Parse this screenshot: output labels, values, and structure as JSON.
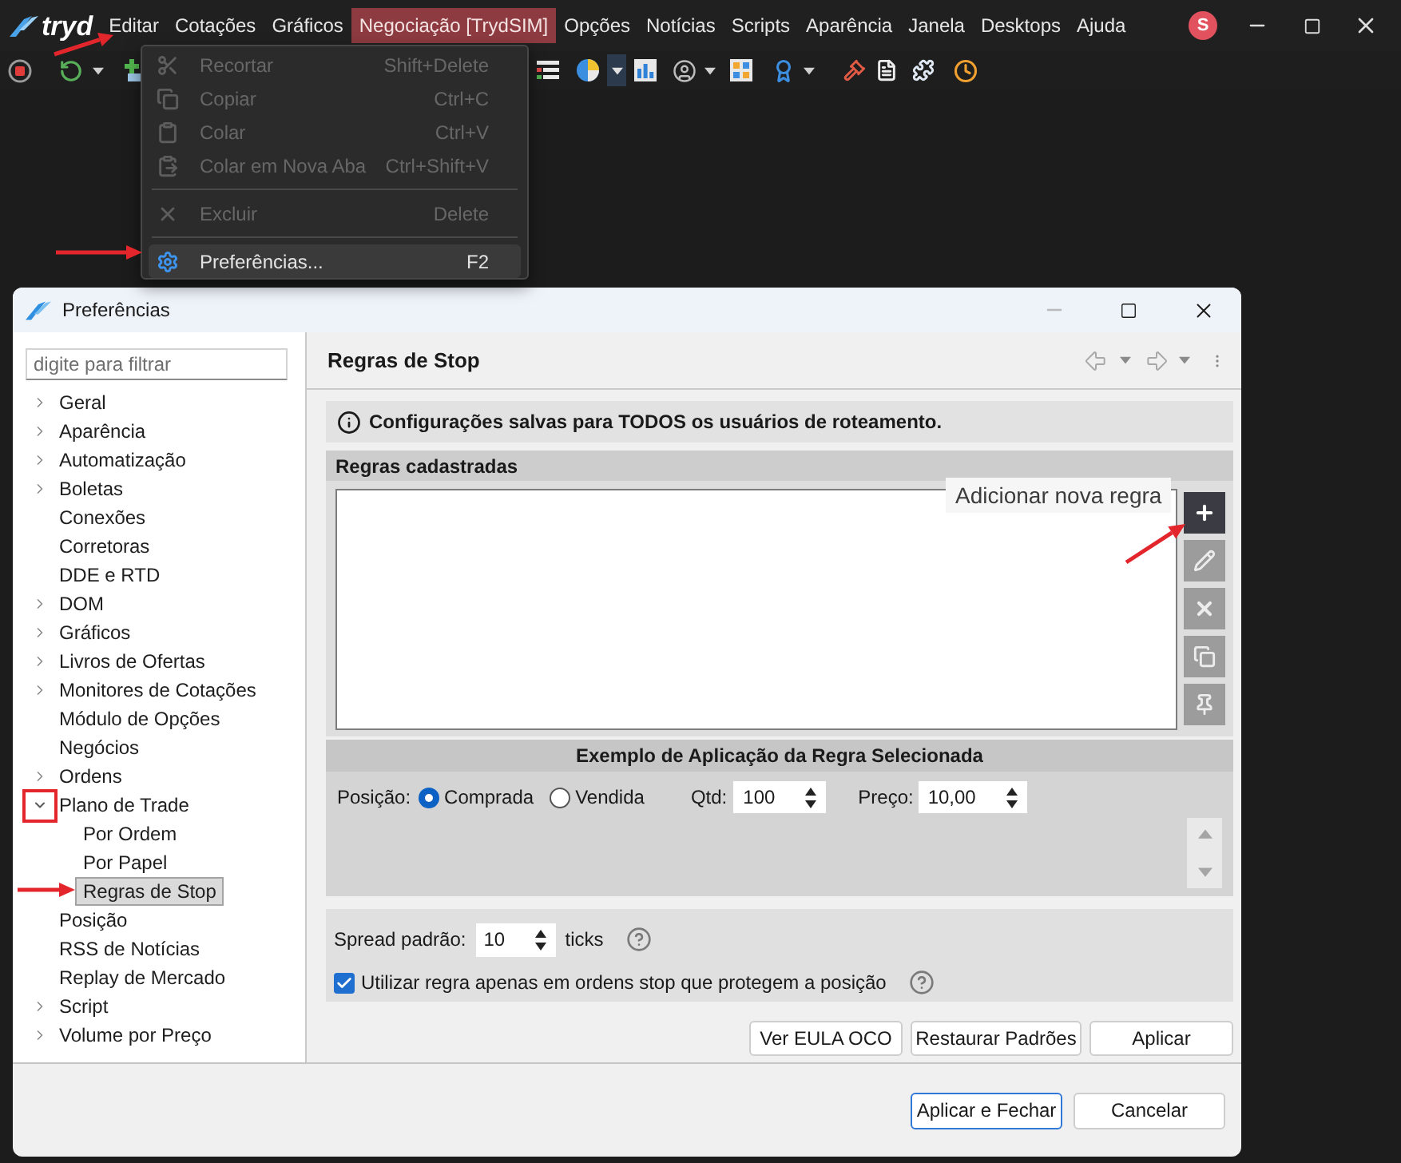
{
  "app": {
    "logo": "tryd"
  },
  "menu_bar": [
    {
      "label": "Editar",
      "highlighted": false
    },
    {
      "label": "Cotações",
      "highlighted": false
    },
    {
      "label": "Gráficos",
      "highlighted": false
    },
    {
      "label": "Negociação [TrydSIM]",
      "highlighted": true
    },
    {
      "label": "Opções",
      "highlighted": false
    },
    {
      "label": "Notícias",
      "highlighted": false
    },
    {
      "label": "Scripts",
      "highlighted": false
    },
    {
      "label": "Aparência",
      "highlighted": false
    },
    {
      "label": "Janela",
      "highlighted": false
    },
    {
      "label": "Desktops",
      "highlighted": false
    },
    {
      "label": "Ajuda",
      "highlighted": false
    }
  ],
  "account": {
    "initial": "S"
  },
  "edit_menu": {
    "items": [
      {
        "kind": "item",
        "label": "Recortar",
        "shortcut": "Shift+Delete",
        "disabled": true,
        "selected": false
      },
      {
        "kind": "item",
        "label": "Copiar",
        "shortcut": "Ctrl+C",
        "disabled": true,
        "selected": false
      },
      {
        "kind": "item",
        "label": "Colar",
        "shortcut": "Ctrl+V",
        "disabled": true,
        "selected": false
      },
      {
        "kind": "item",
        "label": "Colar em Nova Aba",
        "shortcut": "Ctrl+Shift+V",
        "disabled": true,
        "selected": false
      },
      {
        "kind": "separator"
      },
      {
        "kind": "item",
        "label": "Excluir",
        "shortcut": "Delete",
        "disabled": true,
        "selected": false
      },
      {
        "kind": "separator"
      },
      {
        "kind": "item",
        "label": "Preferências...",
        "shortcut": "F2",
        "disabled": false,
        "selected": true
      }
    ]
  },
  "dialog": {
    "title": "Preferências",
    "filter": {
      "placeholder": "digite para filtrar"
    },
    "tree": [
      {
        "label": "Geral",
        "expanded": false,
        "selected": false
      },
      {
        "label": "Aparência",
        "expanded": false,
        "selected": false
      },
      {
        "label": "Automatização",
        "expanded": false,
        "selected": false
      },
      {
        "label": "Boletas",
        "expanded": false,
        "selected": false
      },
      {
        "label": "Conexões",
        "selected": false
      },
      {
        "label": "Corretoras",
        "selected": false
      },
      {
        "label": "DDE e RTD",
        "selected": false
      },
      {
        "label": "DOM",
        "expanded": false,
        "selected": false
      },
      {
        "label": "Gráficos",
        "expanded": false,
        "selected": false
      },
      {
        "label": "Livros de Ofertas",
        "expanded": false,
        "selected": false
      },
      {
        "label": "Monitores de Cotações",
        "expanded": false,
        "selected": false
      },
      {
        "label": "Módulo de Opções",
        "selected": false
      },
      {
        "label": "Negócios",
        "selected": false
      },
      {
        "label": "Ordens",
        "expanded": false,
        "selected": false
      },
      {
        "label": "Plano de Trade",
        "expanded": true,
        "selected": false,
        "children": [
          {
            "label": "Por Ordem",
            "selected": false
          },
          {
            "label": "Por Papel",
            "selected": false
          },
          {
            "label": "Regras de Stop",
            "selected": true
          }
        ]
      },
      {
        "label": "Posição",
        "selected": false
      },
      {
        "label": "RSS de Notícias",
        "selected": false
      },
      {
        "label": "Replay de Mercado",
        "selected": false
      },
      {
        "label": "Script",
        "expanded": false,
        "selected": false
      },
      {
        "label": "Volume por Preço",
        "expanded": false,
        "selected": false
      }
    ],
    "page": {
      "title": "Regras de Stop",
      "info": "Configurações salvas para TODOS os usuários de roteamento.",
      "rules": {
        "title": "Regras cadastradas",
        "tools": [
          {
            "kind": "add",
            "disabled": false
          },
          {
            "kind": "edit",
            "disabled": true
          },
          {
            "kind": "delete",
            "disabled": true
          },
          {
            "kind": "copy",
            "disabled": true
          },
          {
            "kind": "pin",
            "disabled": true
          }
        ],
        "tooltip": "Adicionar nova regra"
      },
      "example": {
        "title": "Exemplo de Aplicação da Regra Selecionada",
        "position_label": "Posição:",
        "positions": [
          {
            "label": "Comprada",
            "selected": true
          },
          {
            "label": "Vendida",
            "selected": false
          }
        ],
        "quantity": {
          "label": "Qtd:",
          "value": "100"
        },
        "price": {
          "label": "Preço:",
          "value": "10,00"
        }
      },
      "spread": {
        "label": "Spread padrão:",
        "value": "10",
        "unit": "ticks"
      },
      "protect_only": {
        "label": "Utilizar regra apenas em ordens stop que protegem a posição",
        "checked": true
      },
      "buttons": [
        "Ver EULA OCO",
        "Restaurar Padrões",
        "Aplicar"
      ]
    },
    "footer_buttons": [
      {
        "label": "Aplicar e Fechar",
        "default": true
      },
      {
        "label": "Cancelar",
        "default": false
      }
    ]
  }
}
